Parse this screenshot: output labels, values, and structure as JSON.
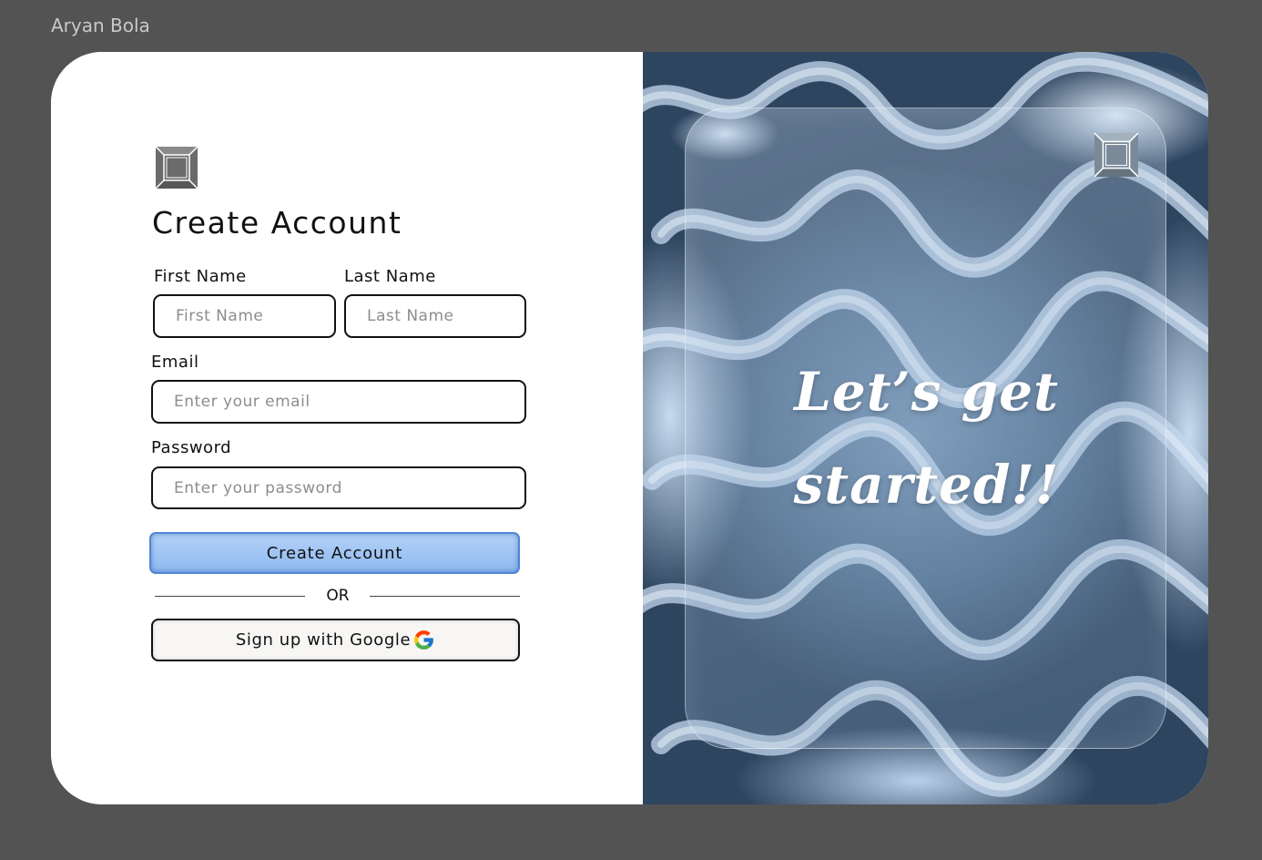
{
  "frame_label": "Aryan Bola",
  "form": {
    "title": "Create Account",
    "first_name": {
      "label": "First Name",
      "placeholder": "First Name",
      "value": ""
    },
    "last_name": {
      "label": "Last Name",
      "placeholder": "Last Name",
      "value": ""
    },
    "email": {
      "label": "Email",
      "placeholder": "Enter your email",
      "value": ""
    },
    "password": {
      "label": "Password",
      "placeholder": "Enter your password",
      "value": ""
    },
    "submit_label": "Create Account",
    "divider_text": "OR",
    "google_label": "Sign up with Google"
  },
  "hero": {
    "line1": "Let’s get",
    "line2": "started!!"
  },
  "colors": {
    "primary_button": "#9dc3f3",
    "primary_border": "#4f86d6",
    "frame_background": "#535353"
  },
  "icons": {
    "logo": "square-frame-icon",
    "google": "google-g-icon"
  }
}
